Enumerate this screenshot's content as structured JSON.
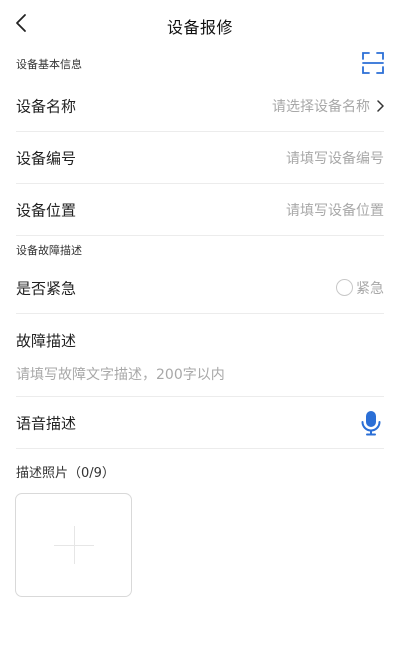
{
  "header": {
    "title": "设备报修",
    "back_icon": "chevron-left-icon"
  },
  "basic_info": {
    "section_label": "设备基本信息",
    "scan_icon": "scan-icon",
    "device_name": {
      "label": "设备名称",
      "placeholder": "请选择设备名称",
      "icon": "chevron-right-icon"
    },
    "device_number": {
      "label": "设备编号",
      "placeholder": "请填写设备编号"
    },
    "device_location": {
      "label": "设备位置",
      "placeholder": "请填写设备位置"
    }
  },
  "fault": {
    "section_label": "设备故障描述",
    "urgent": {
      "label": "是否紧急",
      "option_label": "紧急",
      "checked": false
    },
    "description": {
      "label": "故障描述",
      "placeholder": "请填写故障文字描述，200字以内"
    },
    "voice": {
      "label": "语音描述",
      "icon": "microphone-icon"
    },
    "photos": {
      "label": "描述照片（0/9）",
      "add_icon": "plus-icon"
    }
  },
  "colors": {
    "accent": "#2b6fd6",
    "placeholder": "#a8a8a8",
    "divider": "#ececec"
  }
}
